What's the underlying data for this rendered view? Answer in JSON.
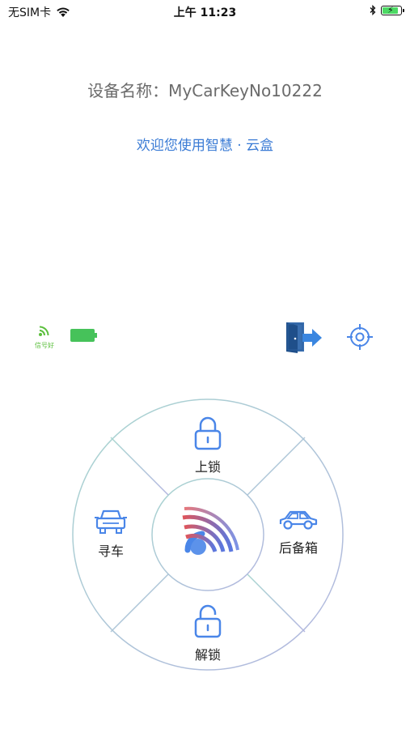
{
  "status_bar": {
    "carrier": "无SIM卡",
    "time": "上午 11:23"
  },
  "header": {
    "device_name": "设备名称：MyCarKeyNo10222",
    "welcome": "欢迎您使用智慧 · 云盒"
  },
  "device_status": {
    "signal_label": "信号好",
    "battery_color": "#46c25a",
    "signal_color": "#5bbf3c"
  },
  "controls": {
    "lock": "上锁",
    "trunk": "后备箱",
    "unlock": "解锁",
    "find_car": "寻车"
  },
  "colors": {
    "accent": "#3a7bd5",
    "icon_blue": "#4a86e8"
  }
}
